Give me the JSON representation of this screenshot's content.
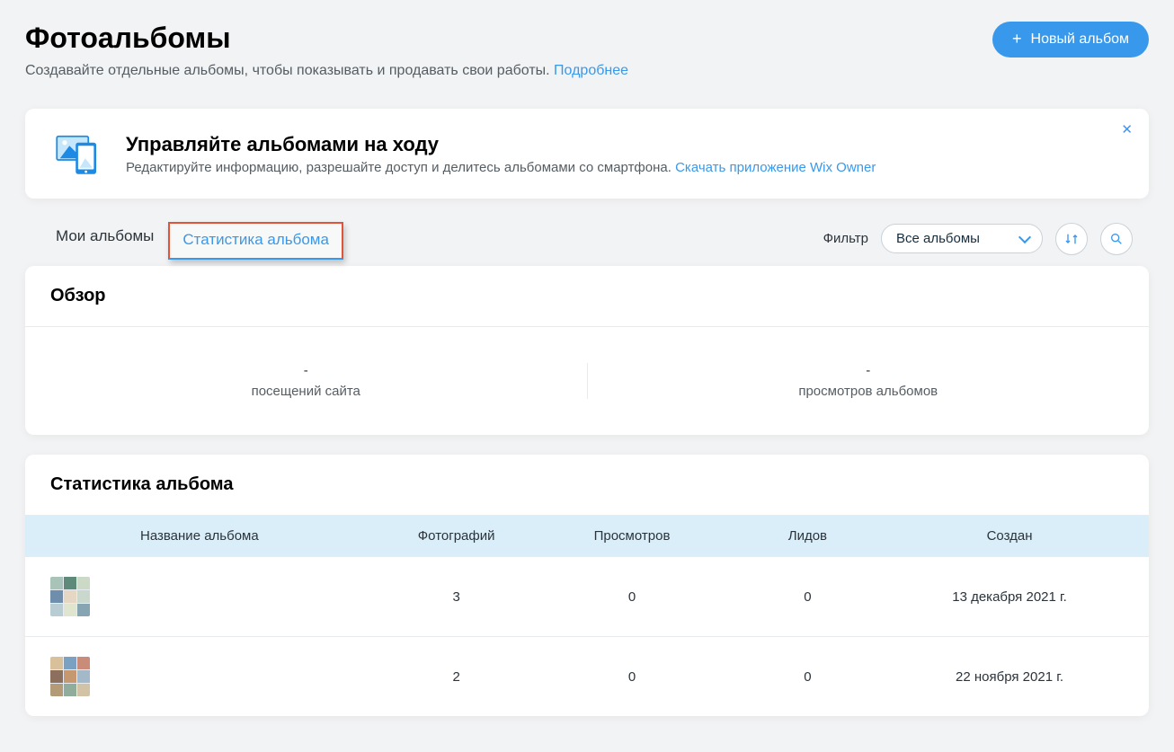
{
  "header": {
    "title": "Фотоальбомы",
    "subtitle": "Создавайте отдельные альбомы, чтобы показывать и продавать свои работы. ",
    "learn_more": "Подробнее",
    "new_album_label": "Новый альбом"
  },
  "promo": {
    "title": "Управляйте альбомами на ходу",
    "text": "Редактируйте информацию, разрешайте доступ и делитесь альбомами со смартфона. ",
    "download_link": "Скачать приложение Wix Owner"
  },
  "tabs": {
    "my_albums": "Мои альбомы",
    "stats": "Статистика альбома"
  },
  "filter": {
    "label": "Фильтр",
    "selected": "Все альбомы"
  },
  "overview": {
    "heading": "Обзор",
    "site_visits_value": "-",
    "site_visits_label": "посещений сайта",
    "album_views_value": "-",
    "album_views_label": "просмотров альбомов"
  },
  "stats": {
    "heading": "Статистика альбома",
    "cols": {
      "name": "Название альбома",
      "photos": "Фотографий",
      "views": "Просмотров",
      "leads": "Лидов",
      "date": "Создан"
    },
    "rows": [
      {
        "name": "",
        "photos": "3",
        "views": "0",
        "leads": "0",
        "date": "13 декабря 2021 г."
      },
      {
        "name": "",
        "photos": "2",
        "views": "0",
        "leads": "0",
        "date": "22 ноября 2021 г."
      }
    ]
  }
}
